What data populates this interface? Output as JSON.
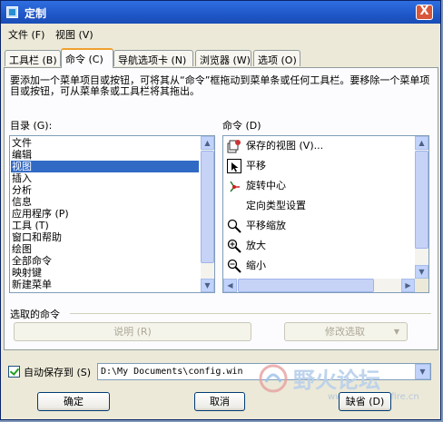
{
  "window": {
    "title": "定制",
    "close_label": "X"
  },
  "menubar": [
    {
      "label": "文件 (F)"
    },
    {
      "label": "视图 (V)"
    }
  ],
  "tabs": [
    {
      "label": "工具栏 (B)"
    },
    {
      "label": "命令 (C)"
    },
    {
      "label": "导航选项卡 (N)"
    },
    {
      "label": "浏览器 (W)"
    },
    {
      "label": "选项 (O)"
    }
  ],
  "active_tab": 1,
  "description": "要添加一个菜单项目或按钮，可将其从“命令”框拖动到菜单条或任何工具栏。要移除一个菜单项目或按钮，可从菜单条或工具栏将其拖出。",
  "categories": {
    "label": "目录 (G):",
    "items": [
      "文件",
      "编辑",
      "视图",
      "插入",
      "分析",
      "信息",
      "应用程序 (P)",
      "工具 (T)",
      "窗口和帮助",
      "绘图",
      "全部命令",
      "映射键",
      "新建菜单"
    ],
    "selected": 2
  },
  "commands": {
    "label": "命令 (D)",
    "items": [
      {
        "label": "保存的视图 (V)...",
        "icon": "saved-views-icon"
      },
      {
        "label": "平移",
        "icon": "pan-icon"
      },
      {
        "label": "旋转中心",
        "icon": "rotate-center-icon"
      },
      {
        "label": "定向类型设置",
        "icon": ""
      },
      {
        "label": "平移缩放",
        "icon": "pan-zoom-icon"
      },
      {
        "label": "放大",
        "icon": "zoom-in-icon"
      },
      {
        "label": "缩小",
        "icon": "zoom-out-icon"
      }
    ]
  },
  "selected_command": {
    "label": "选取的命令",
    "describe_button": "说明 (R)",
    "modify_button": "修改选取"
  },
  "autosave": {
    "label": "自动保存到 (S)",
    "checked": true,
    "path": "D:\\My Documents\\config.win"
  },
  "buttons": {
    "ok": "确定",
    "cancel": "取消",
    "defaults": "缺省 (D)"
  },
  "watermark": {
    "text": "野火论坛",
    "url": "www.proewildfire.cn"
  }
}
